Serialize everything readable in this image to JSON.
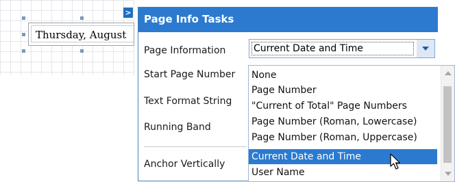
{
  "designer": {
    "label_text": "Thursday, August",
    "smart_tag_glyph": ">"
  },
  "panel": {
    "title": "Page Info Tasks",
    "rows": {
      "page_information": "Page Information",
      "start_page_number": "Start Page Number",
      "text_format_string": "Text Format String",
      "running_band": "Running Band",
      "anchor_vertically": "Anchor Vertically"
    },
    "page_information_value": "Current Date and Time"
  },
  "dropdown": {
    "items": [
      "None",
      "Page Number",
      "\"Current of Total\" Page Numbers",
      "Page Number (Roman, Lowercase)",
      "Page Number (Roman, Uppercase)",
      "Current Date and Time",
      "User Name"
    ],
    "selected_index": 5
  },
  "icons": {
    "smart_tag": "chevron-right-icon",
    "combo_arrow": "chevron-down-icon",
    "cursor": "mouse-pointer-icon"
  },
  "colors": {
    "accent": "#2b7ad0",
    "header_text": "#ffffff",
    "grid": "#e3e6ea",
    "selection_handle": "#7d97b6"
  }
}
